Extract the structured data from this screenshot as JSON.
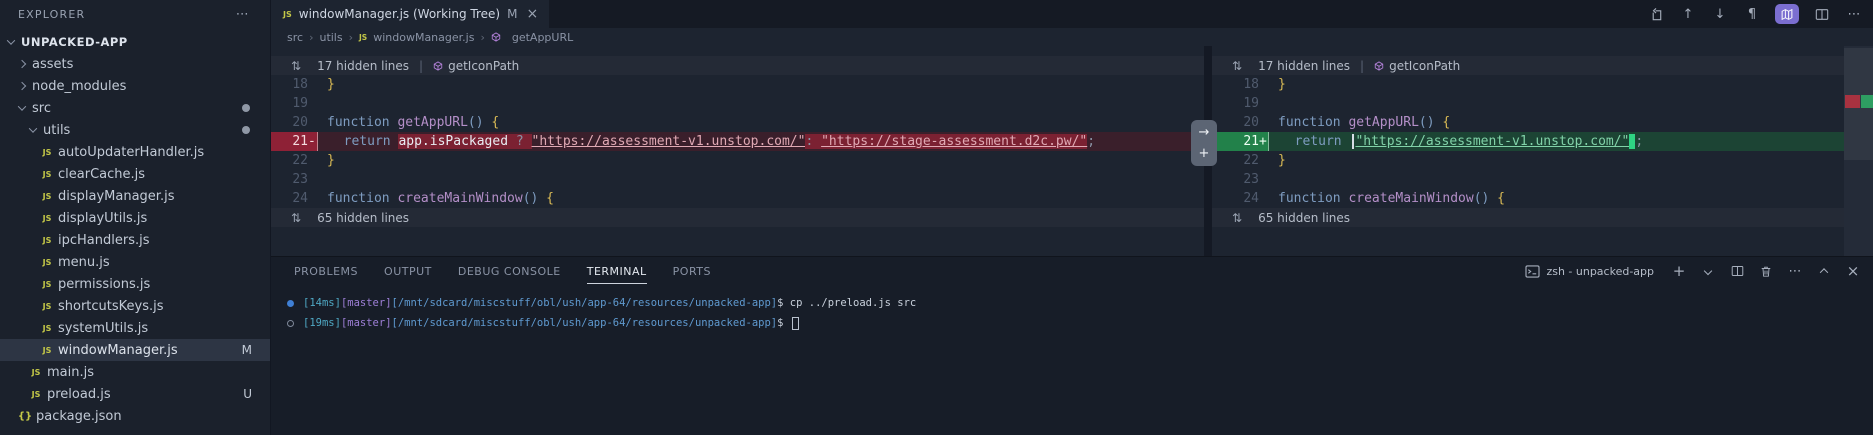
{
  "sidebar": {
    "header": "EXPLORER",
    "more": "⋯",
    "items": [
      {
        "label": "UNPACKED-APP",
        "depth": 0,
        "type": "root",
        "expanded": true
      },
      {
        "label": "assets",
        "depth": 1,
        "type": "folder",
        "expanded": false
      },
      {
        "label": "node_modules",
        "depth": 1,
        "type": "folder",
        "expanded": false
      },
      {
        "label": "src",
        "depth": 1,
        "type": "folder",
        "expanded": true,
        "dot": true
      },
      {
        "label": "utils",
        "depth": 2,
        "type": "folder",
        "expanded": true,
        "dot": true
      },
      {
        "label": "autoUpdaterHandler.js",
        "depth": 3,
        "type": "js"
      },
      {
        "label": "clearCache.js",
        "depth": 3,
        "type": "js"
      },
      {
        "label": "displayManager.js",
        "depth": 3,
        "type": "js"
      },
      {
        "label": "displayUtils.js",
        "depth": 3,
        "type": "js"
      },
      {
        "label": "ipcHandlers.js",
        "depth": 3,
        "type": "js"
      },
      {
        "label": "menu.js",
        "depth": 3,
        "type": "js"
      },
      {
        "label": "permissions.js",
        "depth": 3,
        "type": "js"
      },
      {
        "label": "shortcutsKeys.js",
        "depth": 3,
        "type": "js"
      },
      {
        "label": "systemUtils.js",
        "depth": 3,
        "type": "js"
      },
      {
        "label": "windowManager.js",
        "depth": 3,
        "type": "js",
        "badge": "M",
        "selected": true
      },
      {
        "label": "main.js",
        "depth": 2,
        "type": "js"
      },
      {
        "label": "preload.js",
        "depth": 2,
        "type": "js",
        "badge": "U"
      },
      {
        "label": "package.json",
        "depth": 1,
        "type": "json"
      }
    ]
  },
  "tab": {
    "title": "windowManager.js (Working Tree)",
    "badge": "M",
    "close": "×"
  },
  "editor_actions": {
    "prev": "↑",
    "next": "↓",
    "pilcrow": "¶",
    "more": "⋯"
  },
  "breadcrumb": {
    "sep": "›",
    "items": [
      "src",
      "utils",
      "windowManager.js",
      "getAppURL"
    ]
  },
  "diff": {
    "gutter_widget": {
      "arrow": "→",
      "plus": "+"
    },
    "unfold_glyph": "⇅",
    "left": [
      {
        "kind": "banner",
        "text": "17 hidden lines",
        "sep": "|",
        "symbol": "getIconPath"
      },
      {
        "num": "18",
        "segs": [
          {
            "t": "}",
            "c": "br"
          }
        ]
      },
      {
        "num": "19",
        "segs": []
      },
      {
        "num": "20",
        "segs": [
          {
            "t": "function ",
            "c": "kw"
          },
          {
            "t": "getAppURL",
            "c": "fn"
          },
          {
            "t": "()",
            "c": "pn"
          },
          {
            "t": " ",
            "c": ""
          },
          {
            "t": "{",
            "c": "br"
          }
        ]
      },
      {
        "num": "21",
        "sign": "-",
        "kind": "removed",
        "segs": [
          {
            "t": "  ",
            "c": ""
          },
          {
            "t": "return ",
            "c": "kw"
          },
          {
            "t": "app.isPackaged ",
            "c": "cw hd"
          },
          {
            "t": "? ",
            "c": "pu hd"
          },
          {
            "t": "\"https://assessment-v1.unstop.com/\"",
            "c": "sd"
          },
          {
            "t": ": ",
            "c": "pu hd"
          },
          {
            "t": "\"https://stage-assessment.d2c.pw/\"",
            "c": "sd hd"
          },
          {
            "t": ";",
            "c": "pu"
          }
        ]
      },
      {
        "num": "22",
        "segs": [
          {
            "t": "}",
            "c": "br"
          }
        ]
      },
      {
        "num": "23",
        "segs": []
      },
      {
        "num": "24",
        "segs": [
          {
            "t": "function ",
            "c": "kw"
          },
          {
            "t": "createMainWindow",
            "c": "fn"
          },
          {
            "t": "()",
            "c": "pn"
          },
          {
            "t": " ",
            "c": ""
          },
          {
            "t": "{",
            "c": "br"
          }
        ]
      },
      {
        "kind": "banner",
        "text": "65 hidden lines"
      }
    ],
    "right": [
      {
        "kind": "banner",
        "text": "17 hidden lines",
        "sep": "|",
        "symbol": "getIconPath"
      },
      {
        "num": "18",
        "segs": [
          {
            "t": "}",
            "c": "br"
          }
        ]
      },
      {
        "num": "19",
        "segs": []
      },
      {
        "num": "20",
        "segs": [
          {
            "t": "function ",
            "c": "kw"
          },
          {
            "t": "getAppURL",
            "c": "fn"
          },
          {
            "t": "()",
            "c": "pn"
          },
          {
            "t": " ",
            "c": ""
          },
          {
            "t": "{",
            "c": "br"
          }
        ]
      },
      {
        "num": "21",
        "sign": "+",
        "kind": "added",
        "segs": [
          {
            "t": "  ",
            "c": ""
          },
          {
            "t": "return ",
            "c": "kw"
          },
          {
            "t": "",
            "c": "cbar"
          },
          {
            "t": "\"https://assessment-v1.unstop.com/\"",
            "c": "sa"
          },
          {
            "t": "",
            "c": "cblock"
          },
          {
            "t": ";",
            "c": "pu"
          }
        ]
      },
      {
        "num": "22",
        "segs": [
          {
            "t": "}",
            "c": "br"
          }
        ]
      },
      {
        "num": "23",
        "segs": []
      },
      {
        "num": "24",
        "segs": [
          {
            "t": "function ",
            "c": "kw"
          },
          {
            "t": "createMainWindow",
            "c": "fn"
          },
          {
            "t": "()",
            "c": "pn"
          },
          {
            "t": " ",
            "c": ""
          },
          {
            "t": "{",
            "c": "br"
          }
        ]
      },
      {
        "kind": "banner",
        "text": "65 hidden lines"
      }
    ]
  },
  "panel": {
    "tabs": [
      {
        "label": "PROBLEMS"
      },
      {
        "label": "OUTPUT"
      },
      {
        "label": "DEBUG CONSOLE"
      },
      {
        "label": "TERMINAL",
        "active": true
      },
      {
        "label": "PORTS"
      }
    ],
    "terminal_label": "zsh - unpacked-app",
    "icons": {
      "plus": "+",
      "more": "⋯",
      "close": "×"
    },
    "lines": [
      {
        "bullet": "filled",
        "segs": [
          {
            "t": "[14ms]",
            "c": "tt"
          },
          {
            "t": "[master]",
            "c": "tb"
          },
          {
            "t": "[/mnt/sdcard/miscstuff/obl/ush/app-64/resources/unpacked-app]",
            "c": "tp"
          },
          {
            "t": "$ ",
            "c": "tw"
          },
          {
            "t": "cp ../preload.js src",
            "c": "tw"
          }
        ]
      },
      {
        "bullet": "open",
        "cursor": true,
        "segs": [
          {
            "t": "[19ms]",
            "c": "tt"
          },
          {
            "t": "[master]",
            "c": "tb"
          },
          {
            "t": "[/mnt/sdcard/miscstuff/obl/ush/app-64/resources/unpacked-app]",
            "c": "tp"
          },
          {
            "t": "$ ",
            "c": "tw"
          }
        ]
      }
    ]
  }
}
